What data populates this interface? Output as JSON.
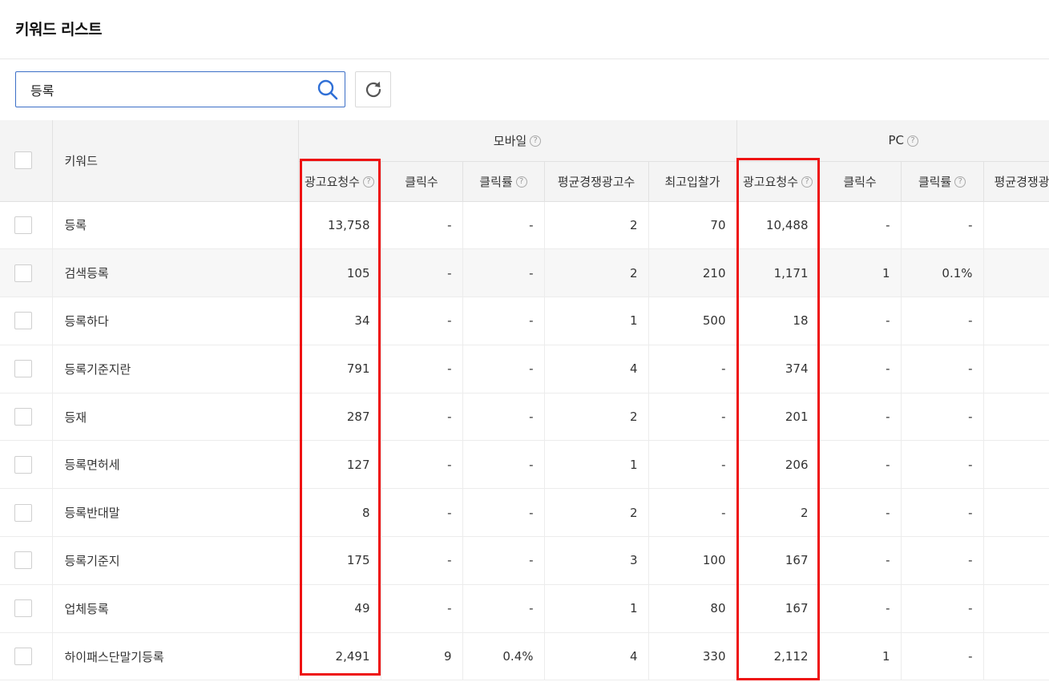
{
  "page": {
    "title": "키워드 리스트"
  },
  "search": {
    "value": "등록"
  },
  "icons": {
    "search": "search-icon",
    "refresh": "refresh-icon",
    "help": "help-circle-icon"
  },
  "colors": {
    "highlight_box": "#e11111",
    "search_border": "#3c6fc7"
  },
  "table": {
    "keyword_header": "키워드",
    "groups": {
      "mobile": "모바일",
      "pc": "PC"
    },
    "columns": {
      "mobile": [
        "광고요청수",
        "클릭수",
        "클릭률",
        "평균경쟁광고수",
        "최고입찰가"
      ],
      "pc": [
        "광고요청수",
        "클릭수",
        "클릭률",
        "평균경쟁광고수"
      ]
    },
    "help_mark": "?",
    "rows": [
      {
        "keyword": "등록",
        "m_req": "13,758",
        "m_click": "-",
        "m_ctr": "-",
        "m_comp": "2",
        "m_bid": "70",
        "p_req": "10,488",
        "p_click": "-",
        "p_ctr": "-"
      },
      {
        "keyword": "검색등록",
        "m_req": "105",
        "m_click": "-",
        "m_ctr": "-",
        "m_comp": "2",
        "m_bid": "210",
        "p_req": "1,171",
        "p_click": "1",
        "p_ctr": "0.1%"
      },
      {
        "keyword": "등록하다",
        "m_req": "34",
        "m_click": "-",
        "m_ctr": "-",
        "m_comp": "1",
        "m_bid": "500",
        "p_req": "18",
        "p_click": "-",
        "p_ctr": "-"
      },
      {
        "keyword": "등록기준지란",
        "m_req": "791",
        "m_click": "-",
        "m_ctr": "-",
        "m_comp": "4",
        "m_bid": "-",
        "p_req": "374",
        "p_click": "-",
        "p_ctr": "-"
      },
      {
        "keyword": "등재",
        "m_req": "287",
        "m_click": "-",
        "m_ctr": "-",
        "m_comp": "2",
        "m_bid": "-",
        "p_req": "201",
        "p_click": "-",
        "p_ctr": "-"
      },
      {
        "keyword": "등록면허세",
        "m_req": "127",
        "m_click": "-",
        "m_ctr": "-",
        "m_comp": "1",
        "m_bid": "-",
        "p_req": "206",
        "p_click": "-",
        "p_ctr": "-"
      },
      {
        "keyword": "등록반대말",
        "m_req": "8",
        "m_click": "-",
        "m_ctr": "-",
        "m_comp": "2",
        "m_bid": "-",
        "p_req": "2",
        "p_click": "-",
        "p_ctr": "-"
      },
      {
        "keyword": "등록기준지",
        "m_req": "175",
        "m_click": "-",
        "m_ctr": "-",
        "m_comp": "3",
        "m_bid": "100",
        "p_req": "167",
        "p_click": "-",
        "p_ctr": "-"
      },
      {
        "keyword": "업체등록",
        "m_req": "49",
        "m_click": "-",
        "m_ctr": "-",
        "m_comp": "1",
        "m_bid": "80",
        "p_req": "167",
        "p_click": "-",
        "p_ctr": "-"
      },
      {
        "keyword": "하이패스단말기등록",
        "m_req": "2,491",
        "m_click": "9",
        "m_ctr": "0.4%",
        "m_comp": "4",
        "m_bid": "330",
        "p_req": "2,112",
        "p_click": "1",
        "p_ctr": "-"
      }
    ]
  }
}
